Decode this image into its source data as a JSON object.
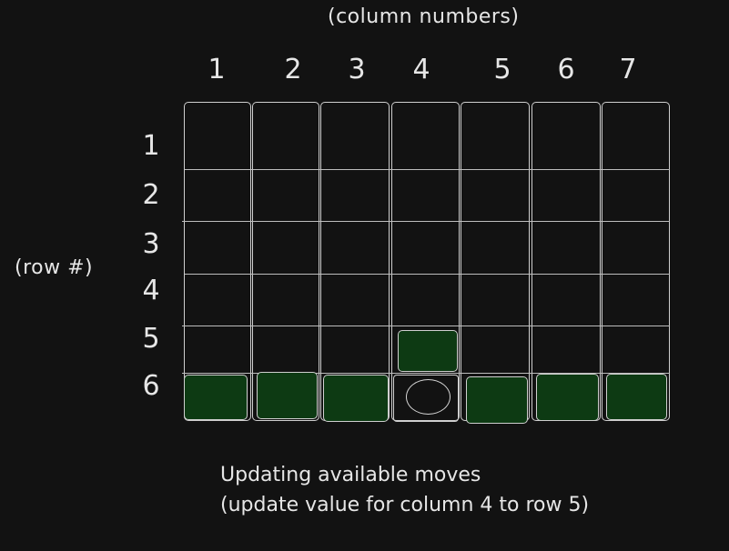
{
  "header": {
    "column_caption": "(column numbers)",
    "row_caption": "(row #)"
  },
  "columns": [
    "1",
    "2",
    "3",
    "4",
    "5",
    "6",
    "7"
  ],
  "rows": [
    "1",
    "2",
    "3",
    "4",
    "5",
    "6"
  ],
  "board": {
    "filled_cells": [
      {
        "row": 6,
        "col": 1
      },
      {
        "row": 6,
        "col": 2
      },
      {
        "row": 6,
        "col": 3
      },
      {
        "row": 6,
        "col": 5
      },
      {
        "row": 6,
        "col": 6
      },
      {
        "row": 6,
        "col": 7
      },
      {
        "row": 5,
        "col": 4
      }
    ],
    "marked_cell": {
      "row": 6,
      "col": 4
    }
  },
  "notes": {
    "line1": "Updating available moves",
    "line2": "(update value for column 4 to row 5)"
  },
  "colors": {
    "background": "#121212",
    "cell_fill": "#0d3a13",
    "line": "#cfcfcf"
  }
}
